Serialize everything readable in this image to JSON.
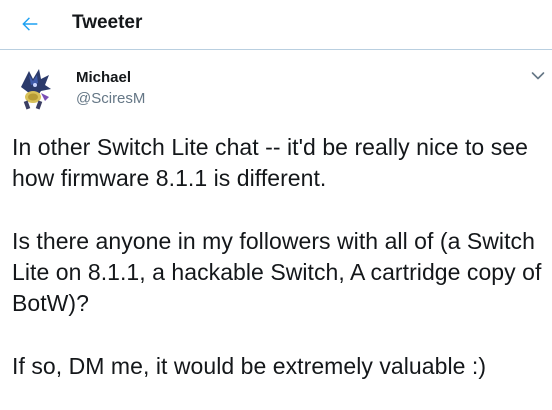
{
  "header": {
    "back_icon": "arrow-left-icon",
    "title": "Tweeter",
    "accent_color": "#1da1f2"
  },
  "tweet": {
    "author": {
      "display_name": "Michael",
      "handle": "@SciresM",
      "avatar_icon": "avatar-image"
    },
    "menu_icon": "chevron-down-icon",
    "text": "In other Switch Lite chat -- it'd be really nice to see how firmware 8.1.1 is different.\n\nIs there anyone in my followers with all of (a Switch Lite on 8.1.1, a hackable Switch, A cartridge copy of BotW)?\n\nIf so, DM me, it would be extremely valuable :)"
  }
}
